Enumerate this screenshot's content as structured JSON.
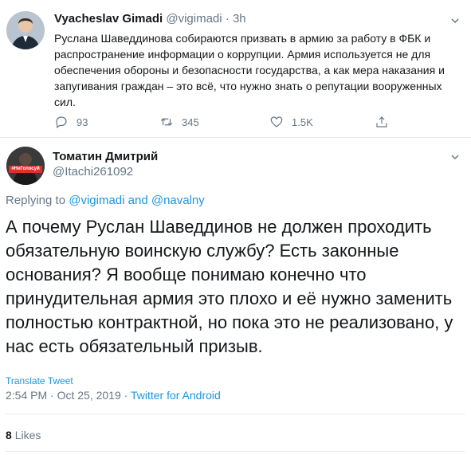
{
  "parent": {
    "name": "Vyacheslav Gimadi",
    "handle": "@vigimadi",
    "sep": "·",
    "time": "3h",
    "text": "Руслана Шаведдинова собираются призвать в армию за работу в ФБК и распространение информации о коррупции. Армия используется не для обеспечения обороны и безопасности государства, а как мера наказания и запугивания граждан – это всё, что нужно знать о репутации вооруженных сил.",
    "replies": "93",
    "retweets": "345",
    "likes": "1.5K"
  },
  "reply": {
    "name": "Томатин Дмитрий",
    "handle": "@Itachi261092",
    "avatar_text": "#НеГолосуй",
    "replying_prefix": "Replying to",
    "replying_to_1": "@vigimadi",
    "replying_and": "and",
    "replying_to_2": "@navalny",
    "text": "А почему Руслан Шаведдинов не должен проходить обязательную воинскую службу? Есть законные основания? Я вообще понимаю конечно что принудительная армия это плохо и её нужно заменить полностью контрактной, но пока это не реализовано, у нас есть обязательный призыв.",
    "translate": "Translate Tweet",
    "time": "2:54 PM",
    "date": "Oct 25, 2019",
    "dot": "·",
    "source": "Twitter for Android",
    "likes_count": "8",
    "likes_label": "Likes"
  },
  "colors": {
    "accent": "#1b95e0",
    "muted": "#657786",
    "border": "#e6ecf0"
  }
}
